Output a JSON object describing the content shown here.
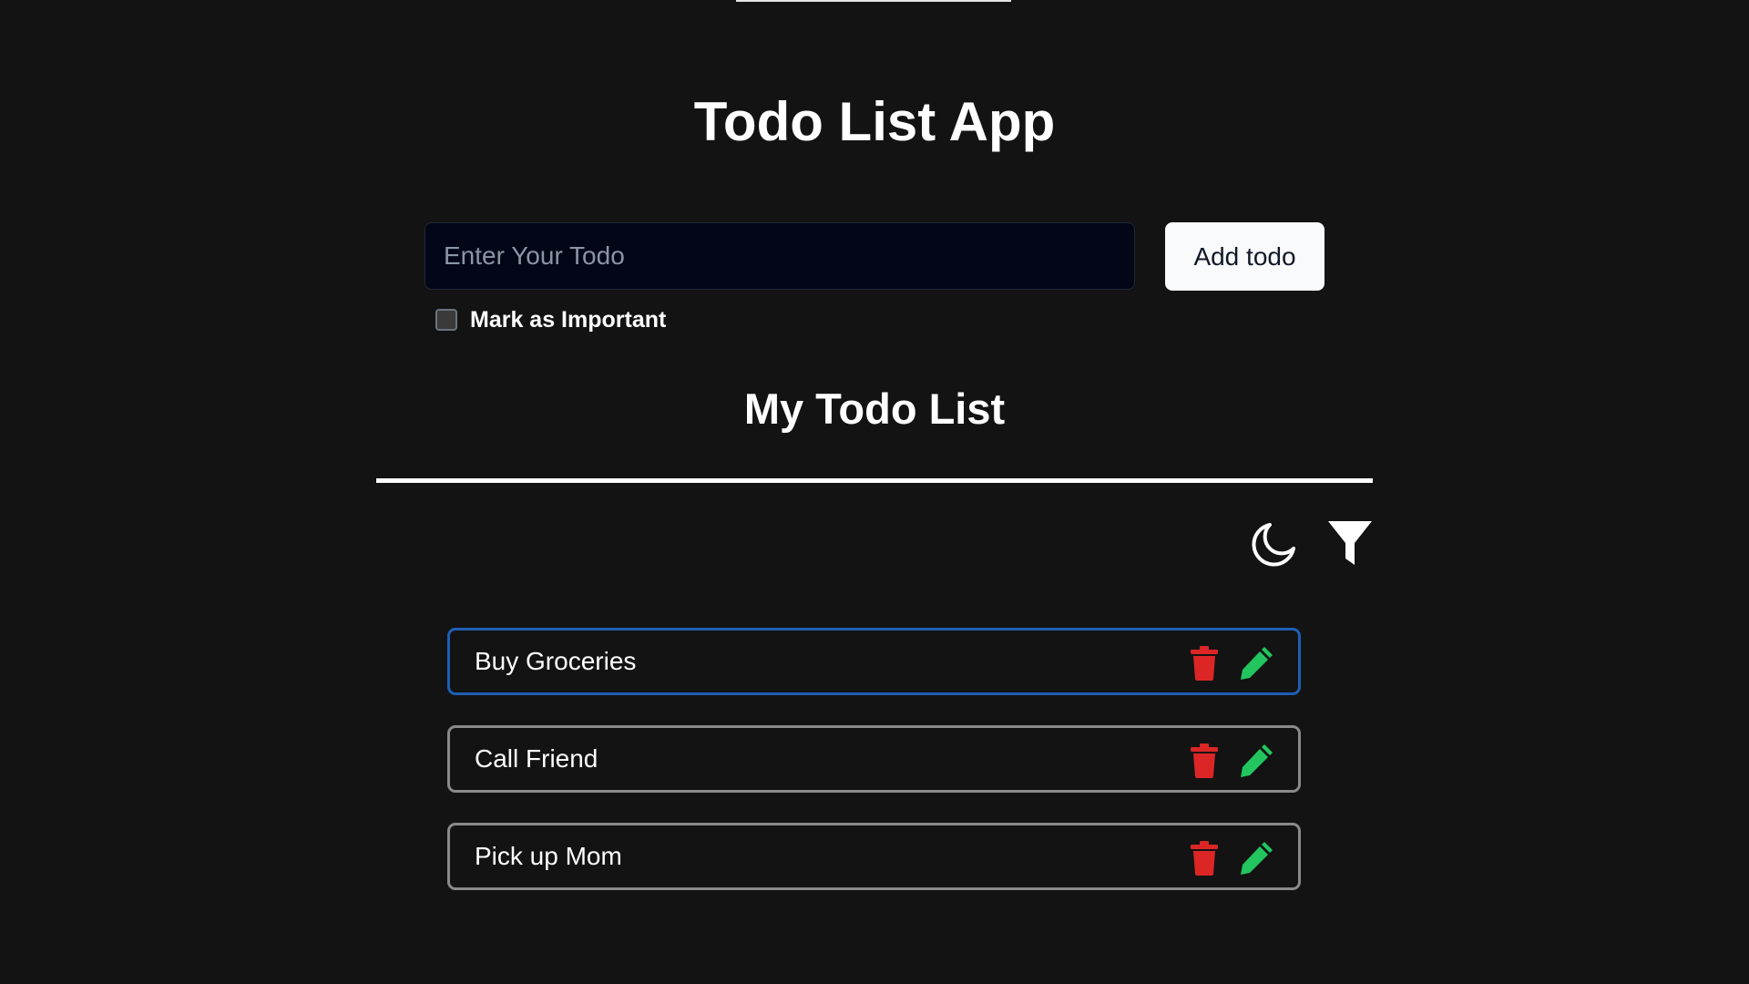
{
  "app": {
    "title": "Todo List App"
  },
  "form": {
    "input_placeholder": "Enter Your Todo",
    "input_value": "",
    "add_label": "Add todo",
    "important_label": "Mark as Important",
    "important_checked": false
  },
  "list": {
    "title": "My Todo List",
    "toolbar_icons": [
      "moon-icon",
      "filter-icon"
    ],
    "items": [
      {
        "text": "Buy Groceries",
        "active": true
      },
      {
        "text": "Call Friend",
        "active": false
      },
      {
        "text": "Pick up Mom",
        "active": false
      }
    ]
  },
  "colors": {
    "background": "#131313",
    "input_background": "#020617",
    "active_border": "#1e5fb4",
    "item_border": "#8a8a8a",
    "delete": "#dc2626",
    "edit": "#22c55e"
  }
}
